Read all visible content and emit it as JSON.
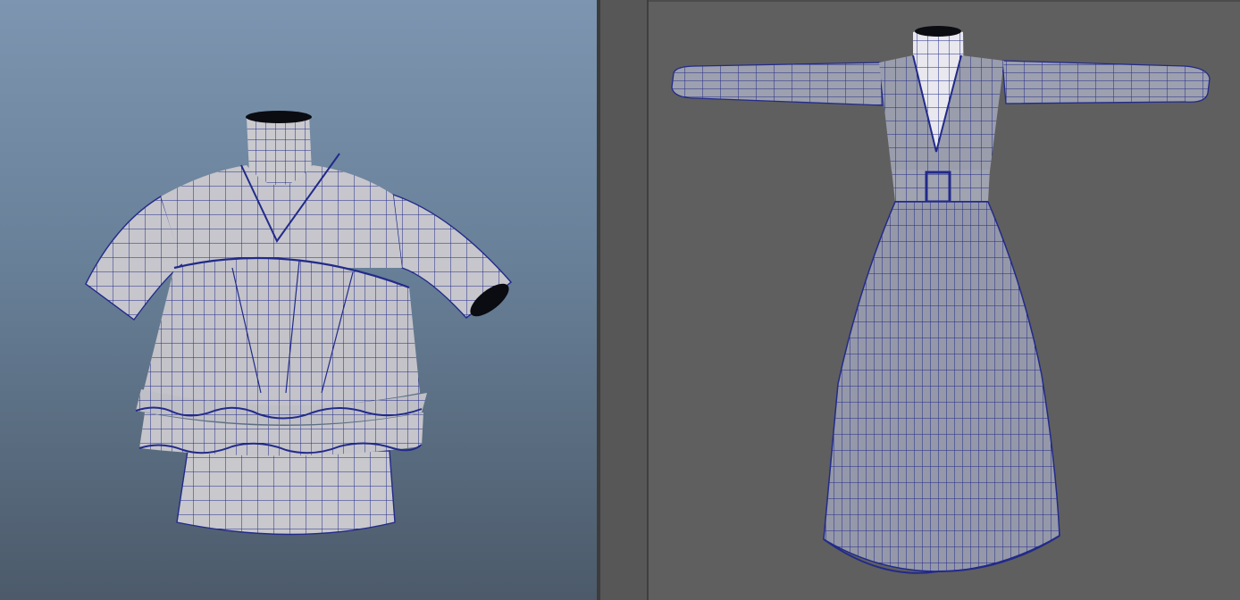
{
  "colors": {
    "left_viewport_top": "#7d95b0",
    "left_viewport_bottom": "#4c5a6a",
    "right_viewport_bg": "#5f5f5f",
    "mesh_fill": "#c6c6cc",
    "wire": "#222a8a",
    "dark_opening": "#0b0b12"
  },
  "viewports": [
    {
      "id": "left",
      "model": "ruffled-blouse-mesh"
    },
    {
      "id": "right",
      "model": "long-dress-mesh"
    }
  ]
}
